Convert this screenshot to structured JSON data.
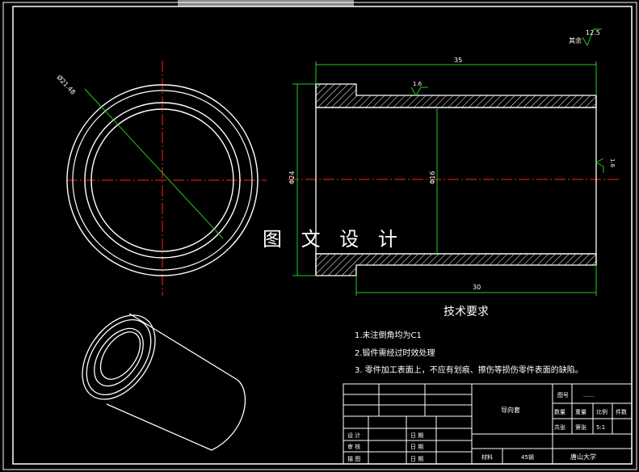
{
  "watermark": "图 文 设 计",
  "dimensions": {
    "diameter_circle": "Ø21.48",
    "length_total": "35",
    "length_bottom": "30",
    "outer_dia": "Φ24",
    "inner_dia": "Φ16",
    "rough_1": "1.6",
    "rough_2": "1.6",
    "rough_general": "12.5",
    "rough_general_label": "其余"
  },
  "tech": {
    "title": "技术要求",
    "items": [
      "1.未注倒角均为C1",
      "2.锻件需经过时效处理",
      "3. 零件加工表面上，不应有划痕、擦伤等损伤零件表面的缺陷。"
    ]
  },
  "title_block": {
    "part_name": "导向套",
    "drawing_no_label": "图号",
    "drawing_no_value": "......",
    "qty_label": "数量",
    "weight_label": "重量",
    "scale_label": "比例",
    "scale_value": "5:1",
    "count_label": "件数",
    "sheet_label": "共张",
    "sheet_label2": "第张",
    "material_label": "材料",
    "material_value": "45钢",
    "school": "唐山大学",
    "design_label": "设 计",
    "check_label": "审 核",
    "approve_label": "描 图",
    "date_label1": "日 期",
    "date_label2": "日 期",
    "date_label3": "日 期"
  }
}
